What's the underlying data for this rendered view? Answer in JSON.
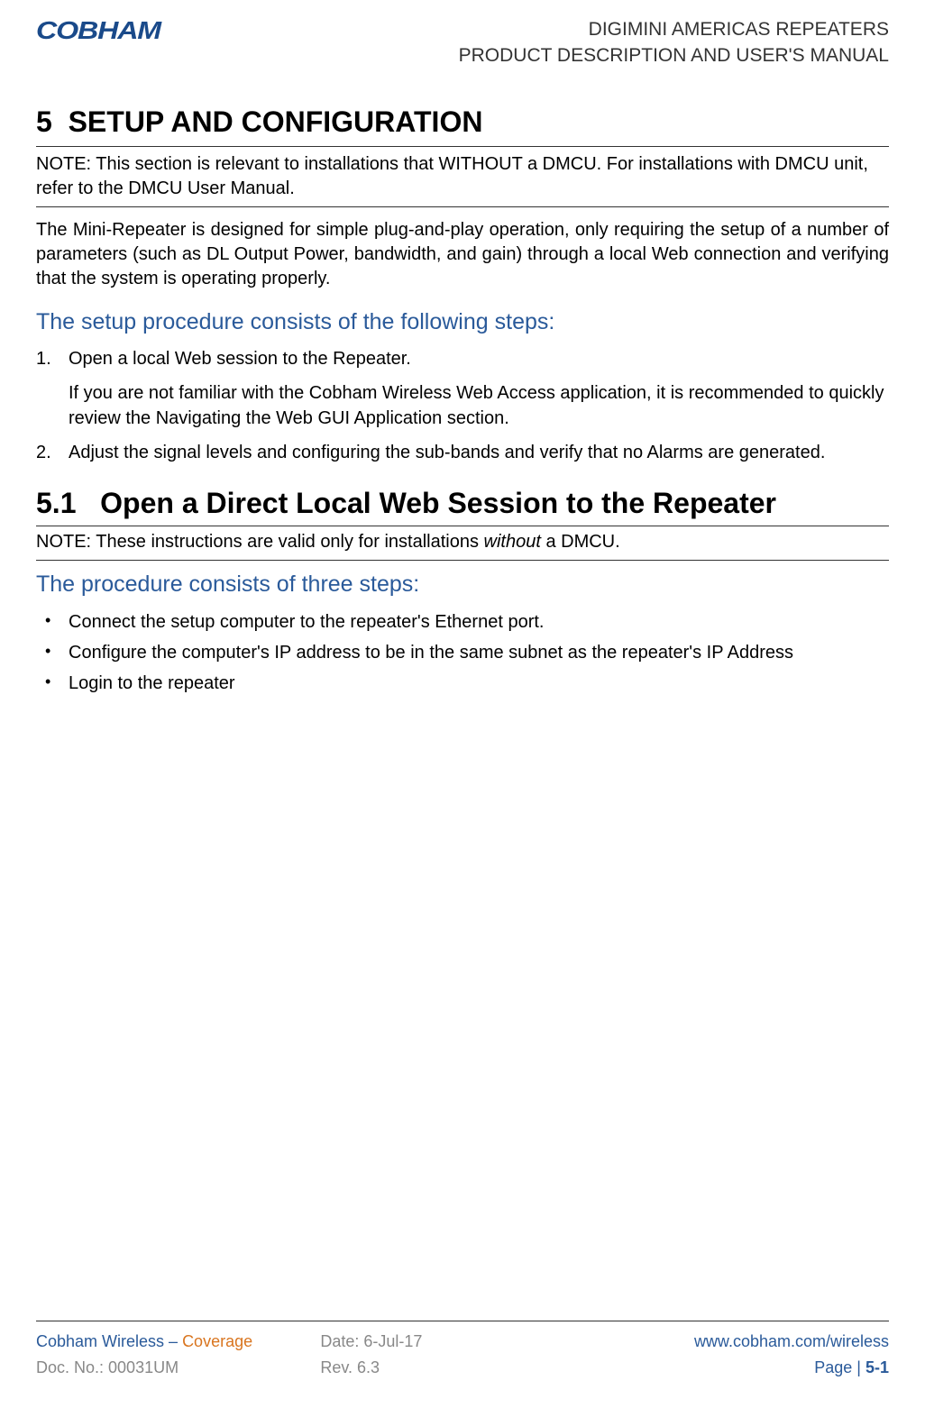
{
  "header": {
    "logo_text": "COBHAM",
    "line1": "DIGIMINI AMERICAS REPEATERS",
    "line2": "PRODUCT DESCRIPTION AND USER'S MANUAL"
  },
  "section": {
    "number": "5",
    "title": "SETUP AND CONFIGURATION",
    "note": "NOTE: This section is relevant to installations that WITHOUT a DMCU. For installations with DMCU unit, refer to the DMCU User Manual.",
    "intro": "The Mini-Repeater is designed for simple plug-and-play operation, only requiring the setup of a number of parameters (such as DL Output Power, bandwidth, and gain) through a local Web connection and verifying that the system is operating properly.",
    "steps_heading": "The setup procedure consists of the following steps:",
    "steps": [
      {
        "num": "1.",
        "text": "Open a local Web session to the Repeater.",
        "sub": "If you are not familiar with the Cobham Wireless Web Access application, it is recommended to quickly review the Navigating the Web GUI Application section."
      },
      {
        "num": "2.",
        "text": "Adjust the signal levels and configuring the sub-bands and verify that no Alarms are generated."
      }
    ]
  },
  "subsection": {
    "number": "5.1",
    "title": "Open a Direct Local Web Session to the Repeater",
    "note_prefix": "NOTE: These instructions are valid only for installations ",
    "note_italic": "without",
    "note_suffix": " a DMCU.",
    "proc_heading": "The procedure consists of three steps:",
    "bullets": [
      "Connect the setup computer to the repeater's Ethernet port.",
      "Configure the computer's IP address to be in the same subnet as the repeater's IP Address",
      "Login to the repeater"
    ]
  },
  "footer": {
    "company": "Cobham Wireless",
    "separator": " – ",
    "tagline": "Coverage",
    "doc_no_label": "Doc. No.: ",
    "doc_no": "00031UM",
    "date_label": "Date: ",
    "date": "6-Jul-17",
    "rev_label": "Rev. ",
    "rev": "6.3",
    "url": "www.cobham.com/wireless",
    "page_label": "Page | ",
    "page": "5-1"
  }
}
